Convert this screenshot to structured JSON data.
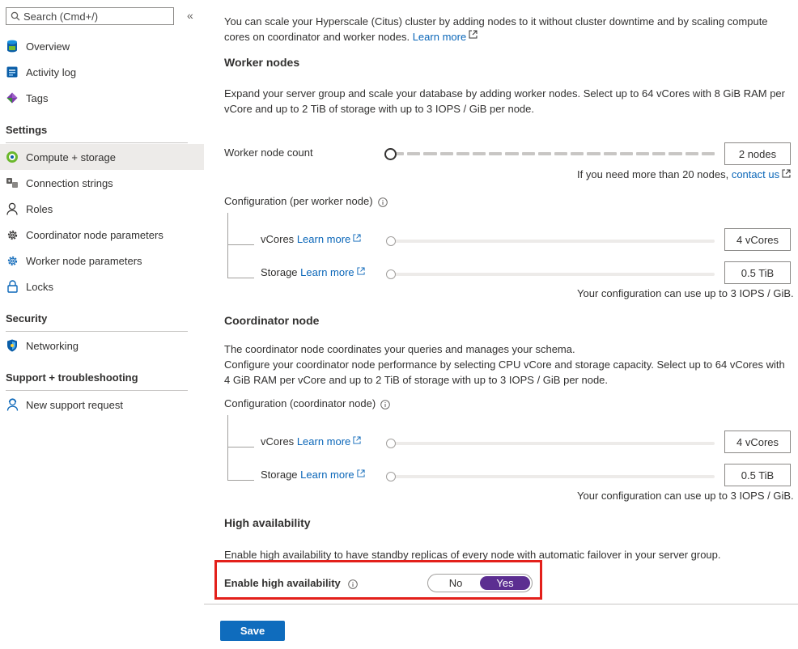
{
  "sidebar": {
    "search_placeholder": "Search (Cmd+/)",
    "collapse_label": "«",
    "items_top": [
      {
        "label": "Overview",
        "icon": "database-icon"
      },
      {
        "label": "Activity log",
        "icon": "activity-log-icon"
      },
      {
        "label": "Tags",
        "icon": "tag-icon"
      }
    ],
    "settings_title": "Settings",
    "settings_items": [
      {
        "label": "Compute + storage",
        "icon": "compute-storage-icon",
        "active": true
      },
      {
        "label": "Connection strings",
        "icon": "connection-strings-icon"
      },
      {
        "label": "Roles",
        "icon": "person-icon"
      },
      {
        "label": "Coordinator node parameters",
        "icon": "gear-icon"
      },
      {
        "label": "Worker node parameters",
        "icon": "gear-icon"
      },
      {
        "label": "Locks",
        "icon": "lock-icon"
      }
    ],
    "security_title": "Security",
    "security_items": [
      {
        "label": "Networking",
        "icon": "shield-icon"
      }
    ],
    "support_title": "Support + troubleshooting",
    "support_items": [
      {
        "label": "New support request",
        "icon": "support-person-icon"
      }
    ]
  },
  "intro": {
    "text": "You can scale your Hyperscale (Citus) cluster by adding nodes to it without cluster downtime and by scaling compute cores on coordinator and worker nodes.",
    "link": "Learn more"
  },
  "worker": {
    "title": "Worker nodes",
    "description": "Expand your server group and scale your database by adding worker nodes. Select up to 64 vCores with 8 GiB RAM per vCore and up to 2 TiB of storage with up to 3 IOPS / GiB per node.",
    "count_label": "Worker node count",
    "count_value": "2 nodes",
    "more_nodes_text": "If you need more than 20 nodes,",
    "contact_link": "contact us",
    "config_label": "Configuration (per worker node)",
    "vcores_label": "vCores",
    "vcores_link": "Learn more",
    "vcores_value": "4 vCores",
    "storage_label": "Storage",
    "storage_link": "Learn more",
    "storage_value": "0.5 TiB",
    "iops_note": "Your configuration can use up to 3 IOPS / GiB."
  },
  "coordinator": {
    "title": "Coordinator node",
    "description_1": "The coordinator node coordinates your queries and manages your schema.",
    "description_2": "Configure your coordinator node performance by selecting CPU vCore and storage capacity. Select up to 64 vCores with 4 GiB RAM per vCore and up to 2 TiB of storage with up to 3 IOPS / GiB per node.",
    "config_label": "Configuration (coordinator node)",
    "vcores_label": "vCores",
    "vcores_link": "Learn more",
    "vcores_value": "4 vCores",
    "storage_label": "Storage",
    "storage_link": "Learn more",
    "storage_value": "0.5 TiB",
    "iops_note": "Your configuration can use up to 3 IOPS / GiB."
  },
  "ha": {
    "title": "High availability",
    "description": "Enable high availability to have standby replicas of every node with automatic failover in your server group.",
    "enable_label": "Enable high availability",
    "option_no": "No",
    "option_yes": "Yes",
    "selected": "Yes"
  },
  "footer": {
    "save_label": "Save"
  },
  "colors": {
    "accent": "#0f6cbd",
    "toggle_selected": "#5c2e91",
    "highlight_border": "#e3201b"
  }
}
